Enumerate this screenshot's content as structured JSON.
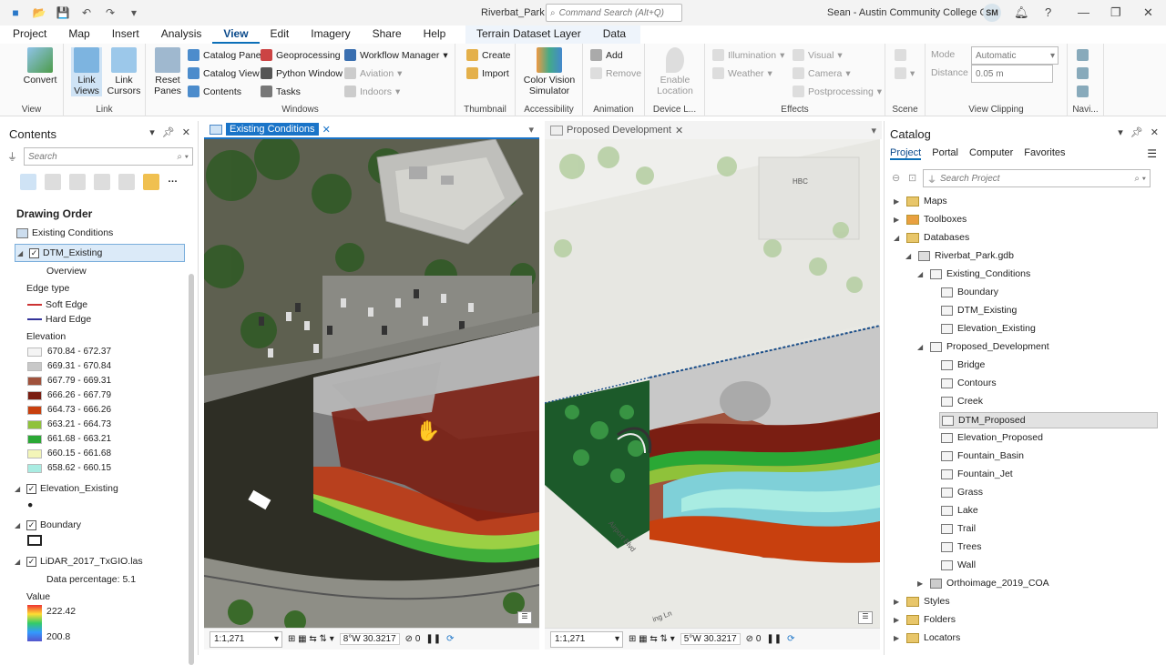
{
  "app": {
    "doc_title": "Riverbat_Park",
    "command_search_placeholder": "Command Search (Alt+Q)",
    "user": "Sean - Austin Community College GIS",
    "avatar": "SM"
  },
  "tabs": [
    "Project",
    "Map",
    "Insert",
    "Analysis",
    "View",
    "Edit",
    "Imagery",
    "Share",
    "Help"
  ],
  "active_tab": "View",
  "context_tabs": [
    "Terrain Dataset Layer",
    "Data"
  ],
  "ribbon": {
    "view": {
      "label": "View",
      "convert": "Convert"
    },
    "link": {
      "label": "Link",
      "link_views": "Link Views",
      "link_cursors": "Link Cursors"
    },
    "windows": {
      "label": "Windows",
      "reset_panes": "Reset Panes",
      "catalog_pane": "Catalog Pane",
      "catalog_view": "Catalog View",
      "contents": "Contents",
      "geoprocessing": "Geoprocessing",
      "python_window": "Python Window",
      "tasks": "Tasks",
      "workflow_manager": "Workflow Manager",
      "aviation": "Aviation",
      "indoors": "Indoors"
    },
    "thumbnail": {
      "label": "Thumbnail",
      "create": "Create",
      "import": "Import"
    },
    "accessibility": {
      "label": "Accessibility",
      "color_vision": "Color Vision Simulator"
    },
    "animation": {
      "label": "Animation",
      "add": "Add",
      "remove": "Remove"
    },
    "device": {
      "label": "Device L...",
      "enable_location": "Enable Location"
    },
    "effects": {
      "label": "Effects",
      "illumination": "Illumination",
      "weather": "Weather",
      "visual": "Visual",
      "camera": "Camera",
      "postprocessing": "Postprocessing"
    },
    "scene": {
      "label": "Scene"
    },
    "clipping": {
      "label": "View Clipping",
      "mode_label": "Mode",
      "mode_value": "Automatic",
      "distance_label": "Distance",
      "distance_value": "0.05  m"
    },
    "navi": {
      "label": "Navi..."
    }
  },
  "contents": {
    "title": "Contents",
    "search_placeholder": "Search",
    "drawing_order": "Drawing Order",
    "map_name": "Existing Conditions",
    "layers": {
      "dtm": "DTM_Existing",
      "overview": "Overview",
      "edge_type": "Edge type",
      "soft_edge": "Soft Edge",
      "hard_edge": "Hard Edge",
      "elevation": "Elevation",
      "elev_existing": "Elevation_Existing",
      "boundary": "Boundary",
      "lidar": "LiDAR_2017_TxGIO.las",
      "data_pct": "Data percentage: 5.1",
      "value": "Value",
      "value_high": "222.42",
      "value_low": "200.8"
    },
    "legend": [
      {
        "label": "670.84 - 672.37",
        "color": "#f4f4f4"
      },
      {
        "label": "669.31 - 670.84",
        "color": "#c8c8c8"
      },
      {
        "label": "667.79 - 669.31",
        "color": "#a0523c"
      },
      {
        "label": "666.26 - 667.79",
        "color": "#7a1e12"
      },
      {
        "label": "664.73 - 666.26",
        "color": "#c8400e"
      },
      {
        "label": "663.21 - 664.73",
        "color": "#8fc23a"
      },
      {
        "label": "661.68 - 663.21",
        "color": "#2aa835"
      },
      {
        "label": "660.15 - 661.68",
        "color": "#f3f5b8"
      },
      {
        "label": "658.62 - 660.15",
        "color": "#a9ece2"
      }
    ]
  },
  "maps": {
    "left_tab": "Existing Conditions",
    "right_tab": "Proposed Development",
    "left_scale": "1:1,271",
    "right_scale": "1:1,271",
    "left_coord": "8°W 30.3217",
    "right_coord": "5°W 30.3217",
    "left_zero": "0",
    "right_zero": "0",
    "label_hbc": "HBC",
    "label_airport": "Airport Blvd",
    "label_ln": "ing Ln"
  },
  "catalog": {
    "title": "Catalog",
    "tabs": [
      "Project",
      "Portal",
      "Computer",
      "Favorites"
    ],
    "search_placeholder": "Search Project",
    "items": {
      "maps": "Maps",
      "toolboxes": "Toolboxes",
      "databases": "Databases",
      "gdb": "Riverbat_Park.gdb",
      "existing_conditions": "Existing_Conditions",
      "boundary": "Boundary",
      "dtm_existing": "DTM_Existing",
      "elev_existing": "Elevation_Existing",
      "proposed": "Proposed_Development",
      "bridge": "Bridge",
      "contours": "Contours",
      "creek": "Creek",
      "dtm_proposed": "DTM_Proposed",
      "elev_proposed": "Elevation_Proposed",
      "fountain_basin": "Fountain_Basin",
      "fountain_jet": "Fountain_Jet",
      "grass": "Grass",
      "lake": "Lake",
      "trail": "Trail",
      "trees": "Trees",
      "wall": "Wall",
      "ortho": "Orthoimage_2019_COA",
      "styles": "Styles",
      "folders": "Folders",
      "locators": "Locators"
    }
  }
}
